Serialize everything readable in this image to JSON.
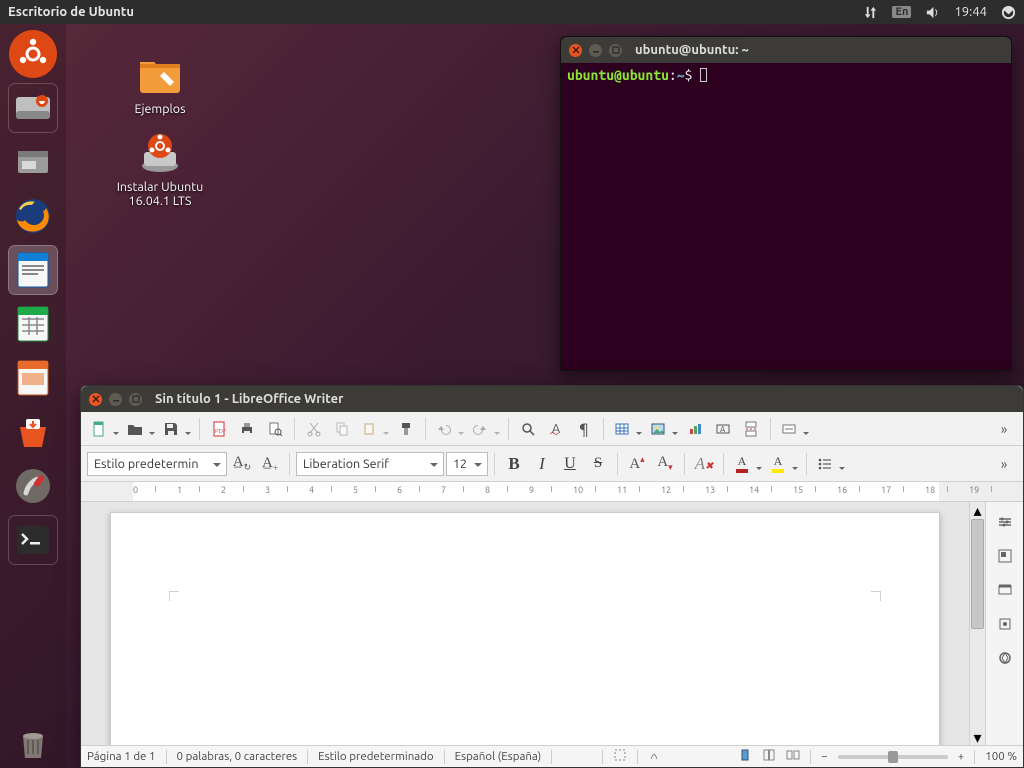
{
  "panel": {
    "title": "Escritorio de Ubuntu",
    "lang": "En",
    "time": "19:44"
  },
  "desktop": {
    "examples": "Ejemplos",
    "install": "Instalar Ubuntu 16.04.1 LTS"
  },
  "terminal": {
    "title": "ubuntu@ubuntu: ~",
    "prompt_user": "ubuntu@ubuntu",
    "prompt_sep": ":",
    "prompt_path": "~",
    "prompt_sym": "$"
  },
  "writer": {
    "title": "Sin título 1 - LibreOffice Writer",
    "style": "Estilo predeterminado",
    "style_short": "Estilo predetermin",
    "font": "Liberation Serif",
    "size": "12",
    "status_page": "Página 1 de 1",
    "status_words": "0 palabras, 0 caracteres",
    "status_style": "Estilo predeterminado",
    "status_lang": "Español (España)",
    "zoom": "100 %"
  }
}
